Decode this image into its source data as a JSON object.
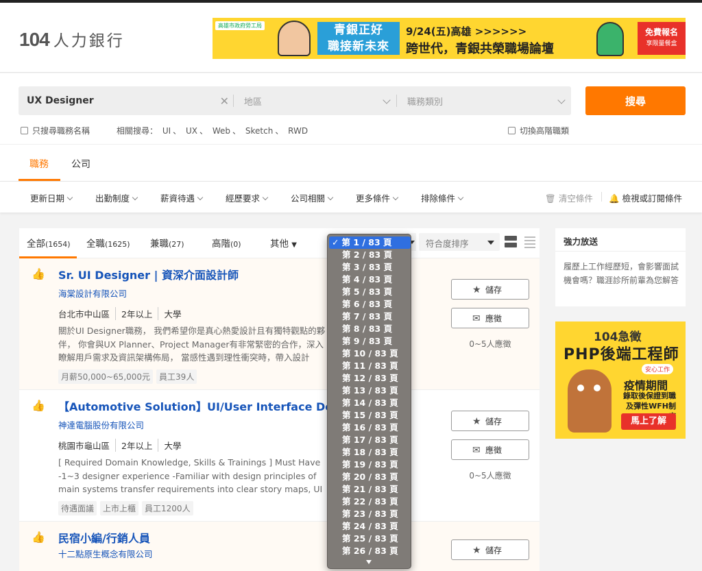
{
  "header": {
    "logo_number": "104",
    "logo_text": "人力銀行",
    "banner": {
      "gov": "高雄市政府勞工局",
      "slogan_line1": "青銀正好",
      "slogan_line2": "職接新未來",
      "date_text": "9/24(五)高雄 >>>>>>",
      "title": "跨世代，青銀共榮職場論壇",
      "cta": "免費報名",
      "cta_sub": "享限量餐盒"
    }
  },
  "search": {
    "keyword": "UX Designer",
    "area_placeholder": "地區",
    "category_placeholder": "職務類別",
    "button_label": "搜尋",
    "only_title_label": "只搜尋職務名稱",
    "related_label": "相關搜尋：",
    "related": [
      "UI",
      "UX",
      "Web",
      "Sketch",
      "RWD"
    ],
    "related_sep": "、",
    "senior_label": "切換高階職類"
  },
  "tabs": {
    "jobs": "職務",
    "company": "公司"
  },
  "filters": {
    "items": [
      "更新日期",
      "出勤制度",
      "薪資待遇",
      "經歷要求",
      "公司相關",
      "更多條件",
      "排除條件"
    ],
    "clear": "清空條件",
    "subscribe": "檢視或訂閱條件"
  },
  "subtabs": {
    "all": "全部",
    "all_count": "(1654)",
    "full": "全職",
    "full_count": "(1625)",
    "part": "兼職",
    "part_count": "(27)",
    "senior": "高階",
    "senior_count": "(0)",
    "other": "其他"
  },
  "sort": {
    "label": "符合度排序"
  },
  "pagination": {
    "current": 1,
    "total": 83,
    "visible_options": [
      "第 1 / 83 頁",
      "第 2 / 83 頁",
      "第 3 / 83 頁",
      "第 4 / 83 頁",
      "第 5 / 83 頁",
      "第 6 / 83 頁",
      "第 7 / 83 頁",
      "第 8 / 83 頁",
      "第 9 / 83 頁",
      "第 10 / 83 頁",
      "第 11 / 83 頁",
      "第 12 / 83 頁",
      "第 13 / 83 頁",
      "第 14 / 83 頁",
      "第 15 / 83 頁",
      "第 16 / 83 頁",
      "第 17 / 83 頁",
      "第 18 / 83 頁",
      "第 19 / 83 頁",
      "第 20 / 83 頁",
      "第 21 / 83 頁",
      "第 22 / 83 頁",
      "第 23 / 83 頁",
      "第 24 / 83 頁",
      "第 25 / 83 頁",
      "第 26 / 83 頁"
    ],
    "check": "✓"
  },
  "jobs": [
    {
      "title": "Sr. UI Designer | 資深介面設計師",
      "company": "海棠設計有限公司",
      "location": "台北市中山區",
      "experience": "2年以上",
      "education": "大學",
      "description": "關於UI Designer職務， 我們希望你是真心熱愛設計且有獨特觀點的夥伴， 你會與UX Planner、Project Manager有非常緊密的合作，深入瞭解用戶需求及資訊架構佈局， 當感性遇到理性衝突時，帶入設計",
      "tags": [
        "月薪50,000~65,000元",
        "員工39人"
      ],
      "save": "儲存",
      "apply": "應徵",
      "applicants": "0~5人應徵"
    },
    {
      "title": "【Automotive Solution】UI/User Interface Designer",
      "company": "神達電腦股份有限公司",
      "location": "桃園市龜山區",
      "experience": "2年以上",
      "education": "大學",
      "description": "[ Required Domain Knowledge, Skills & Trainings ] Must Have -1~3 designer experience -Familiar with design principles of main systems transfer requirements into clear story maps, UI flows, prototypes, and",
      "tags": [
        "待遇面議",
        "上市上櫃",
        "員工1200人"
      ],
      "save": "儲存",
      "apply": "應徵",
      "applicants": "0~5人應徵"
    },
    {
      "title": "民宿小編/行銷人員",
      "company": "十二點原生概念有限公司",
      "save": "儲存"
    }
  ],
  "sidebar": {
    "title": "強力放送",
    "text": "履歷上工作經歷短，會影響面試機會嗎？職涯診所前輩為您解答",
    "ad": {
      "brand": "104急徵",
      "title": "PHP後端工程師",
      "badge": "安心工作",
      "headline": "疫情期間",
      "sub": "錄取後保證到職及彈性WFH制度",
      "cta": "馬上了解"
    }
  },
  "colors": {
    "accent": "#ff7800",
    "link": "#1654b9",
    "select_highlight": "#2f6fe0"
  }
}
